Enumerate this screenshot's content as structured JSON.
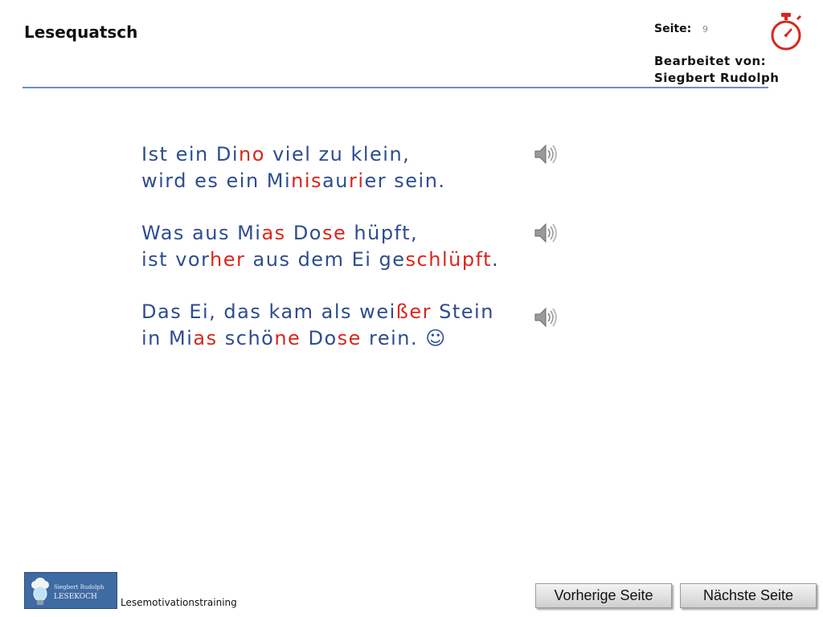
{
  "header": {
    "title": "Lesequatsch",
    "seite_label": "Seite:",
    "seite_value": "9",
    "editor_label": "Bearbeitet von:",
    "editor_name": "Siegbert Rudolph",
    "timer_icon": "stopwatch-icon"
  },
  "poem": {
    "stanzas": [
      {
        "lines": [
          [
            {
              "t": "Ist ein Di",
              "hl": false
            },
            {
              "t": "no",
              "hl": true
            },
            {
              "t": " viel zu klein,",
              "hl": false
            }
          ],
          [
            {
              "t": "wird es ein Mi",
              "hl": false
            },
            {
              "t": "nis",
              "hl": true
            },
            {
              "t": "au",
              "hl": false
            },
            {
              "t": "ri",
              "hl": true
            },
            {
              "t": "er sein.",
              "hl": false
            }
          ]
        ]
      },
      {
        "lines": [
          [
            {
              "t": "Was aus Mi",
              "hl": false
            },
            {
              "t": "as",
              "hl": true
            },
            {
              "t": " Do",
              "hl": false
            },
            {
              "t": "se",
              "hl": true
            },
            {
              "t": " hüpft,",
              "hl": false
            }
          ],
          [
            {
              "t": "ist vor",
              "hl": false
            },
            {
              "t": "her",
              "hl": true
            },
            {
              "t": " aus dem Ei ge",
              "hl": false
            },
            {
              "t": "schlüpft",
              "hl": true
            },
            {
              "t": ".",
              "hl": false
            }
          ]
        ]
      },
      {
        "lines": [
          [
            {
              "t": "Das Ei, das kam als wei",
              "hl": false
            },
            {
              "t": "ßer",
              "hl": true
            },
            {
              "t": " Stein",
              "hl": false
            }
          ],
          [
            {
              "t": "in Mi",
              "hl": false
            },
            {
              "t": "as",
              "hl": true
            },
            {
              "t": " schö",
              "hl": false
            },
            {
              "t": "ne",
              "hl": true
            },
            {
              "t": " Do",
              "hl": false
            },
            {
              "t": "se",
              "hl": true
            },
            {
              "t": " rein.  ☺",
              "hl": false
            }
          ]
        ]
      }
    ],
    "colors": {
      "text": "#2e4d8f",
      "highlight": "#d9261c"
    }
  },
  "audio": {
    "icon": "speaker-icon"
  },
  "footer": {
    "logo_top": "Siegbert Rudolph",
    "logo_bottom": "LESEKOCH",
    "caption": "Lesemotivationstraining",
    "prev_label": "Vorherige Seite",
    "next_label": "Nächste Seite"
  }
}
